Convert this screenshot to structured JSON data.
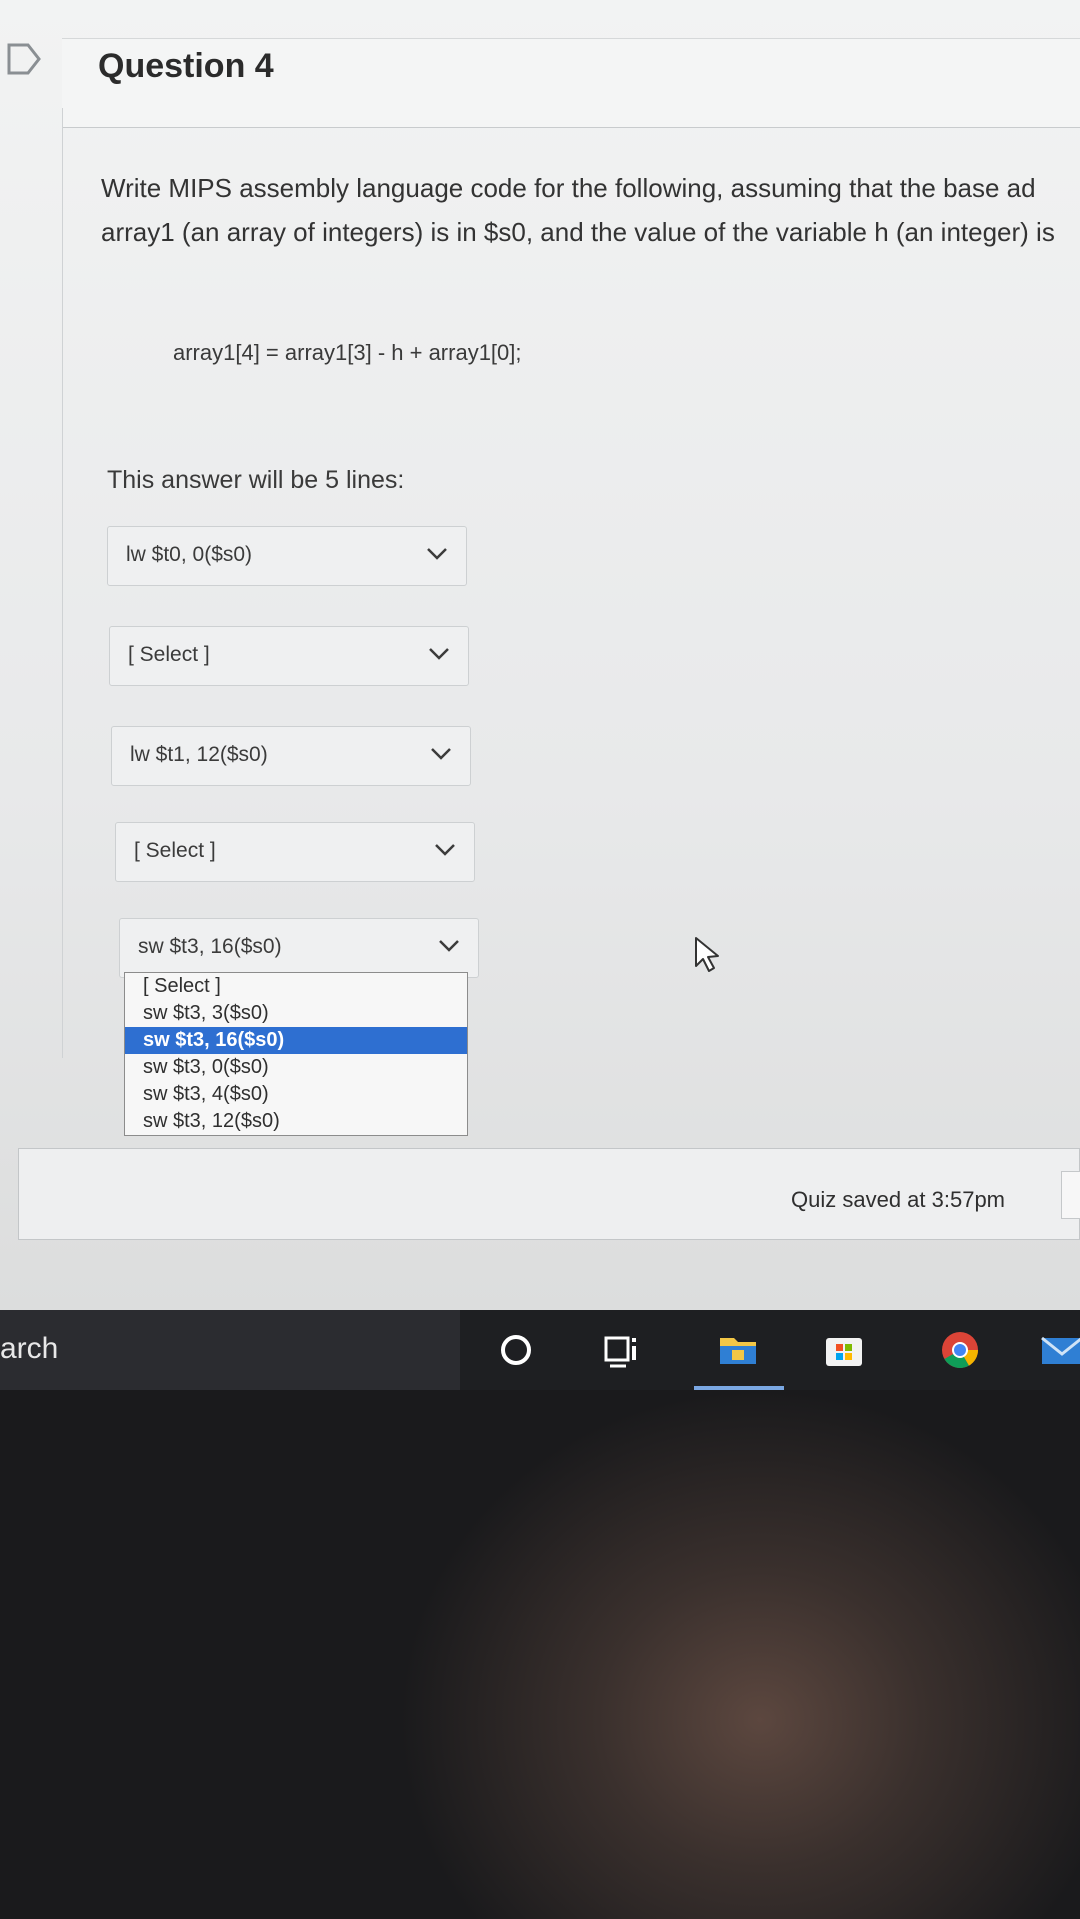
{
  "question": {
    "title": "Question 4",
    "prompt_line1": "Write MIPS assembly language code for the following, assuming that the base ad",
    "prompt_line2": "array1 (an array of integers) is in $s0, and the value of the variable h (an integer) is",
    "formula": "array1[4] = array1[3] - h + array1[0];",
    "lines_note": "This answer will be 5 lines:"
  },
  "answers": [
    {
      "selected": "lw $t0, 0($s0)"
    },
    {
      "selected": "[ Select ]"
    },
    {
      "selected": "lw $t1, 12($s0)"
    },
    {
      "selected": "[ Select ]"
    },
    {
      "selected": "sw $t3, 16($s0)"
    }
  ],
  "dropdown_open": {
    "options": [
      "[ Select ]",
      "sw $t3, 3($s0)",
      "sw $t3, 16($s0)",
      "sw $t3, 0($s0)",
      "sw $t3, 4($s0)",
      "sw $t3, 12($s0)"
    ],
    "highlighted": "sw $t3, 16($s0)"
  },
  "footer": {
    "saved_text": "Quiz saved at 3:57pm"
  },
  "taskbar": {
    "search_text": "arch"
  },
  "colors": {
    "highlight": "#2e6fd1",
    "taskbar": "#1e1f22"
  },
  "icons": [
    "flag-icon",
    "chevron-down-icon",
    "mouse-cursor-icon",
    "cortana-icon",
    "task-view-icon",
    "file-explorer-icon",
    "store-icon",
    "chrome-icon",
    "mail-icon"
  ]
}
